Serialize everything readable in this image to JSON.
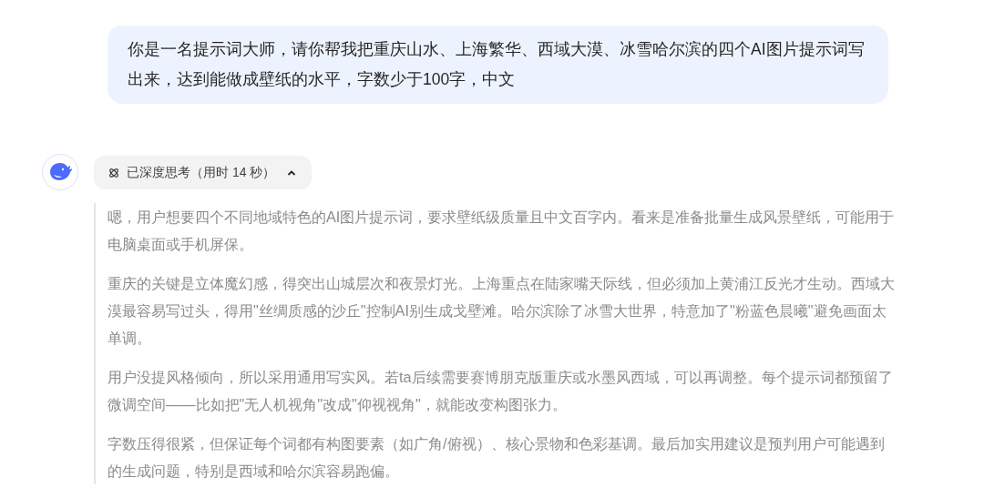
{
  "user_message": "你是一名提示词大师，请你帮我把重庆山水、上海繁华、西域大漠、冰雪哈尔滨的四个AI图片提示词写出来，达到能做成壁纸的水平，字数少于100字，中文",
  "thinking": {
    "label": "已深度思考（用时 14 秒）",
    "expanded": true,
    "paragraphs": [
      "嗯，用户想要四个不同地域特色的AI图片提示词，要求壁纸级质量且中文百字内。看来是准备批量生成风景壁纸，可能用于电脑桌面或手机屏保。",
      "重庆的关键是立体魔幻感，得突出山城层次和夜景灯光。上海重点在陆家嘴天际线，但必须加上黄浦江反光才生动。西域大漠最容易写过头，得用\"丝绸质感的沙丘\"控制AI别生成戈壁滩。哈尔滨除了冰雪大世界，特意加了\"粉蓝色晨曦\"避免画面太单调。",
      "用户没提风格倾向，所以采用通用写实风。若ta后续需要赛博朋克版重庆或水墨风西域，可以再调整。每个提示词都预留了微调空间——比如把\"无人机视角\"改成\"仰视视角\"，就能改变构图张力。",
      "字数压得很紧，但保证每个词都有构图要素（如广角/俯视）、核心景物和色彩基调。最后加实用建议是预判用户可能遇到的生成问题，特别是西域和哈尔滨容易跑偏。"
    ]
  }
}
